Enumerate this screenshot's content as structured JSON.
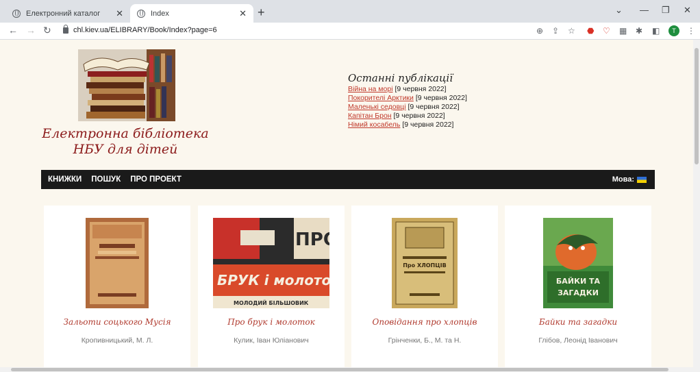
{
  "browser": {
    "tabs": [
      {
        "title": "Електронний каталог",
        "active": false
      },
      {
        "title": "Index",
        "active": true
      }
    ],
    "url": "chl.kiev.ua/ELIBRARY/Book/Index?page=6",
    "profile_initial": "T"
  },
  "site": {
    "title_line1": "Електронна бібліотека",
    "title_line2": "НБУ для дітей"
  },
  "recent": {
    "heading": "Останні публікації",
    "items": [
      {
        "title": "Війна на морі",
        "date": "[9 червня 2022]"
      },
      {
        "title": "Покорителі Арктики",
        "date": "[9 червня 2022]"
      },
      {
        "title": "Маленькі седовці",
        "date": "[9 червня 2022]"
      },
      {
        "title": "Капітан Брон",
        "date": "[9 червня 2022]"
      },
      {
        "title": "Німий косабель",
        "date": "[9 червня 2022]"
      }
    ]
  },
  "nav": {
    "books": "КНИЖКИ",
    "search": "ПОШУК",
    "about": "ПРО ПРОЕКТ",
    "lang_label": "Мова:"
  },
  "books": [
    {
      "title": "Зальоти соцького Мусія",
      "author": "Кропивницький, М. Л."
    },
    {
      "title": "Про брук і молоток",
      "author": "Кулик, Іван Юліанович"
    },
    {
      "title": "Оповідання про хлопців",
      "author": "Грінченки, Б., М. та Н."
    },
    {
      "title": "Байки та загадки",
      "author": "Глібов, Леонід Іванович"
    }
  ],
  "covers": {
    "book2_line1": "ПРО",
    "book2_line2": "БРУК і молоток",
    "book2_publisher": "МОЛОДИЙ БІЛЬШОВИК",
    "book3_title": "Про ХЛОПЦІВ",
    "book4_line1": "БАЙКИ ТА",
    "book4_line2": "ЗАГАДКИ"
  }
}
